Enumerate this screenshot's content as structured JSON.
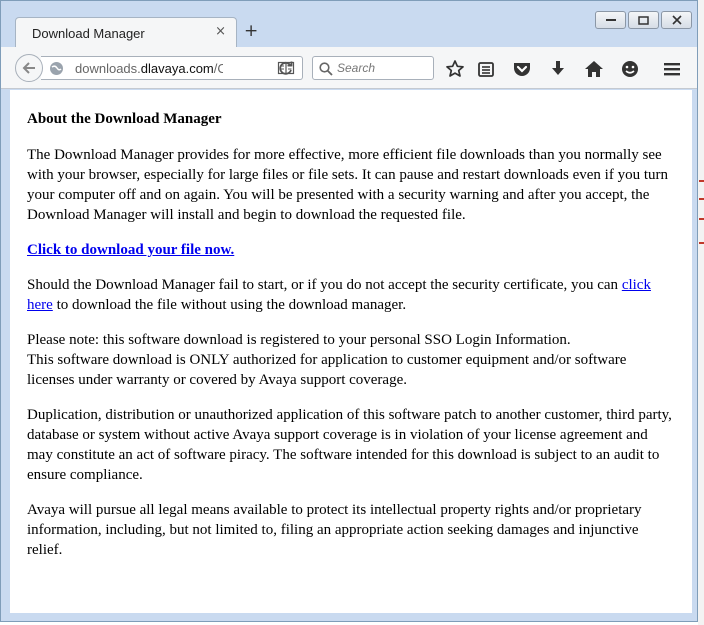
{
  "browser": {
    "tab_title": "Download Manager",
    "tab_close": "×",
    "new_tab": "+",
    "url_prefix": "downloads.",
    "url_host": "dlavaya.com",
    "url_suffix": "/Cc",
    "search_placeholder": "Search",
    "window_buttons": [
      "minimize-icon",
      "restore-icon",
      "close-icon"
    ],
    "toolbar_icons": [
      "bookmark-star-icon",
      "reading-list-icon",
      "pocket-icon",
      "downloads-icon",
      "home-icon",
      "hello-icon",
      "menu-icon"
    ]
  },
  "page": {
    "heading": "About the Download Manager",
    "intro": "The Download Manager provides for more effective, more efficient file downloads than you normally see with your browser, especially for large files or file sets. It can pause and restart downloads even if you turn your computer off and on again. You will be presented with a security warning and after you accept, the Download Manager will install and begin to download the requested file.",
    "download_link": "Click to download your file now.",
    "fail_text_1": "Should the Download Manager fail to start, or if you do not accept the security certificate, you can ",
    "fail_link": "click here",
    "fail_text_2": " to download the file without using the download manager.",
    "note_line_1": "Please note: this software download is registered to your personal SSO Login Information.",
    "note_line_2": "This software download is ONLY authorized for application to customer equipment and/or software licenses under warranty or covered by Avaya support coverage.",
    "duplication": "Duplication, distribution or unauthorized application of this software patch to another customer, third party, database or system without active Avaya support coverage is in violation of your license agreement and may constitute an act of software piracy. The software intended for this download is subject to an audit to ensure compliance.",
    "legal": "Avaya will pursue all legal means available to protect its intellectual property rights and/or proprietary information, including, but not limited to, filing an appropriate action seeking damages and injunctive relief."
  },
  "colors": {
    "chrome": "#c9daf0",
    "link": "#0000ee"
  }
}
